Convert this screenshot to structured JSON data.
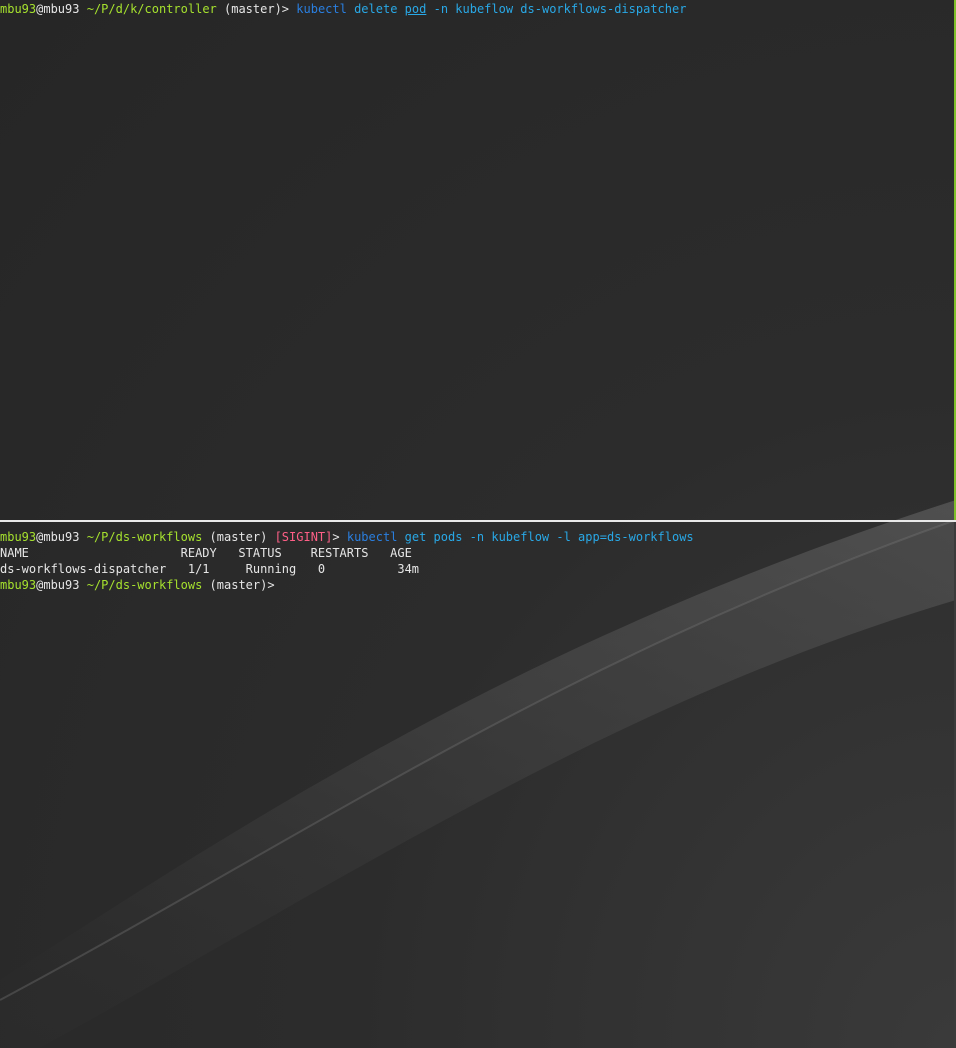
{
  "terminal_top": {
    "prompt": {
      "user": "mbu93",
      "at": "@",
      "host": "mbu93",
      "cwd": "~/P/d/k/controller",
      "branch": "(master)",
      "gt": ">"
    },
    "command": {
      "bin": "kubectl",
      "arg1": "delete",
      "arg2": "pod",
      "rest": "-n kubeflow ds-workflows-dispatcher"
    }
  },
  "terminal_bottom": {
    "prompt1": {
      "user": "mbu93",
      "at": "@",
      "host": "mbu93",
      "cwd": "~/P/ds-workflows",
      "branch": "(master)",
      "signal": "[SIGINT]",
      "gt": ">"
    },
    "command": {
      "bin": "kubectl",
      "rest": "get pods -n kubeflow -l app=ds-workflows"
    },
    "table": {
      "header": "NAME                     READY   STATUS    RESTARTS   AGE",
      "rows": [
        "ds-workflows-dispatcher   1/1     Running   0          34m"
      ]
    },
    "prompt2": {
      "user": "mbu93",
      "at": "@",
      "host": "mbu93",
      "cwd": "~/P/ds-workflows",
      "branch": "(master)",
      "gt": ">"
    }
  },
  "colors": {
    "prompt_user": "#a6e22e",
    "command": "#29a8e6",
    "signal": "#ff5f87",
    "text": "#e6e6e6",
    "background": "#2a2a2a"
  }
}
